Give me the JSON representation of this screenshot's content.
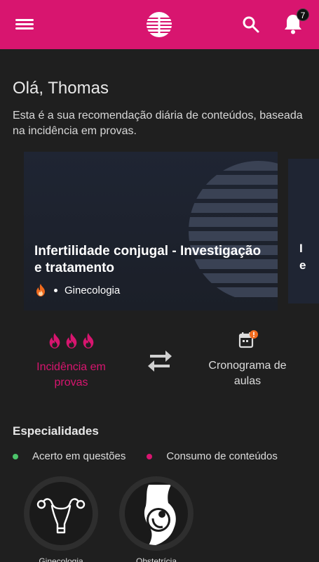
{
  "header": {
    "notification_count": "7",
    "accent": "#d8156f",
    "icons": [
      "menu-icon",
      "logo-icon",
      "search-icon",
      "bell-icon"
    ]
  },
  "greeting": "Olá, Thomas",
  "subtitle": "Esta é a sua recomendação diária de conteúdos, baseada na incidência em provas.",
  "cards": [
    {
      "title": "Infertilidade conjugal - Investigação e tratamento",
      "category": "Ginecologia",
      "icon": "flame-icon"
    },
    {
      "peek_line1": "I",
      "peek_line2": "e"
    }
  ],
  "stats": {
    "incidence_label": "Incidência em provas",
    "incidence_icon": "flame-icon",
    "schedule_label": "Cronograma de aulas",
    "schedule_icon": "calendar-alert-icon",
    "swap_icon": "swap-arrows-icon"
  },
  "specialties": {
    "title": "Especialidades",
    "legend": [
      {
        "label": "Acerto em questões",
        "color": "#4cc46a"
      },
      {
        "label": "Consumo de conteúdos",
        "color": "#d8156f"
      }
    ],
    "items": [
      {
        "label": "Ginecologia",
        "icon": "uterus-icon"
      },
      {
        "label": "Obstetrícia",
        "icon": "pregnancy-icon"
      }
    ]
  }
}
